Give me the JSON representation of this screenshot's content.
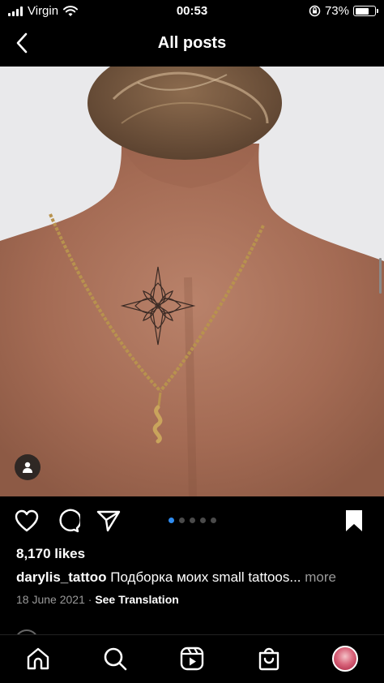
{
  "status_bar": {
    "carrier": "Virgin",
    "time": "00:53",
    "battery_percent": "73%",
    "battery_level": 0.73,
    "icons": [
      "signal-icon",
      "wifi-icon",
      "orientation-lock-icon",
      "battery-icon"
    ]
  },
  "header": {
    "title": "All posts",
    "back_icon": "chevron-left-icon"
  },
  "post": {
    "carousel": {
      "total": 5,
      "active_index": 0
    },
    "likes": "8,170 likes",
    "username": "darylis_tattoo",
    "caption": "Подборка моих small tattoos...",
    "more_label": "more",
    "date": "18 June 2021",
    "separator": "·",
    "translation_label": "See Translation"
  },
  "colors": {
    "background": "#000000",
    "text": "#ffffff",
    "muted": "#9a9a9a",
    "carousel_active": "#2f8cf0"
  },
  "tab_bar": [
    "home-icon",
    "search-icon",
    "reels-icon",
    "shop-icon",
    "profile-avatar"
  ]
}
